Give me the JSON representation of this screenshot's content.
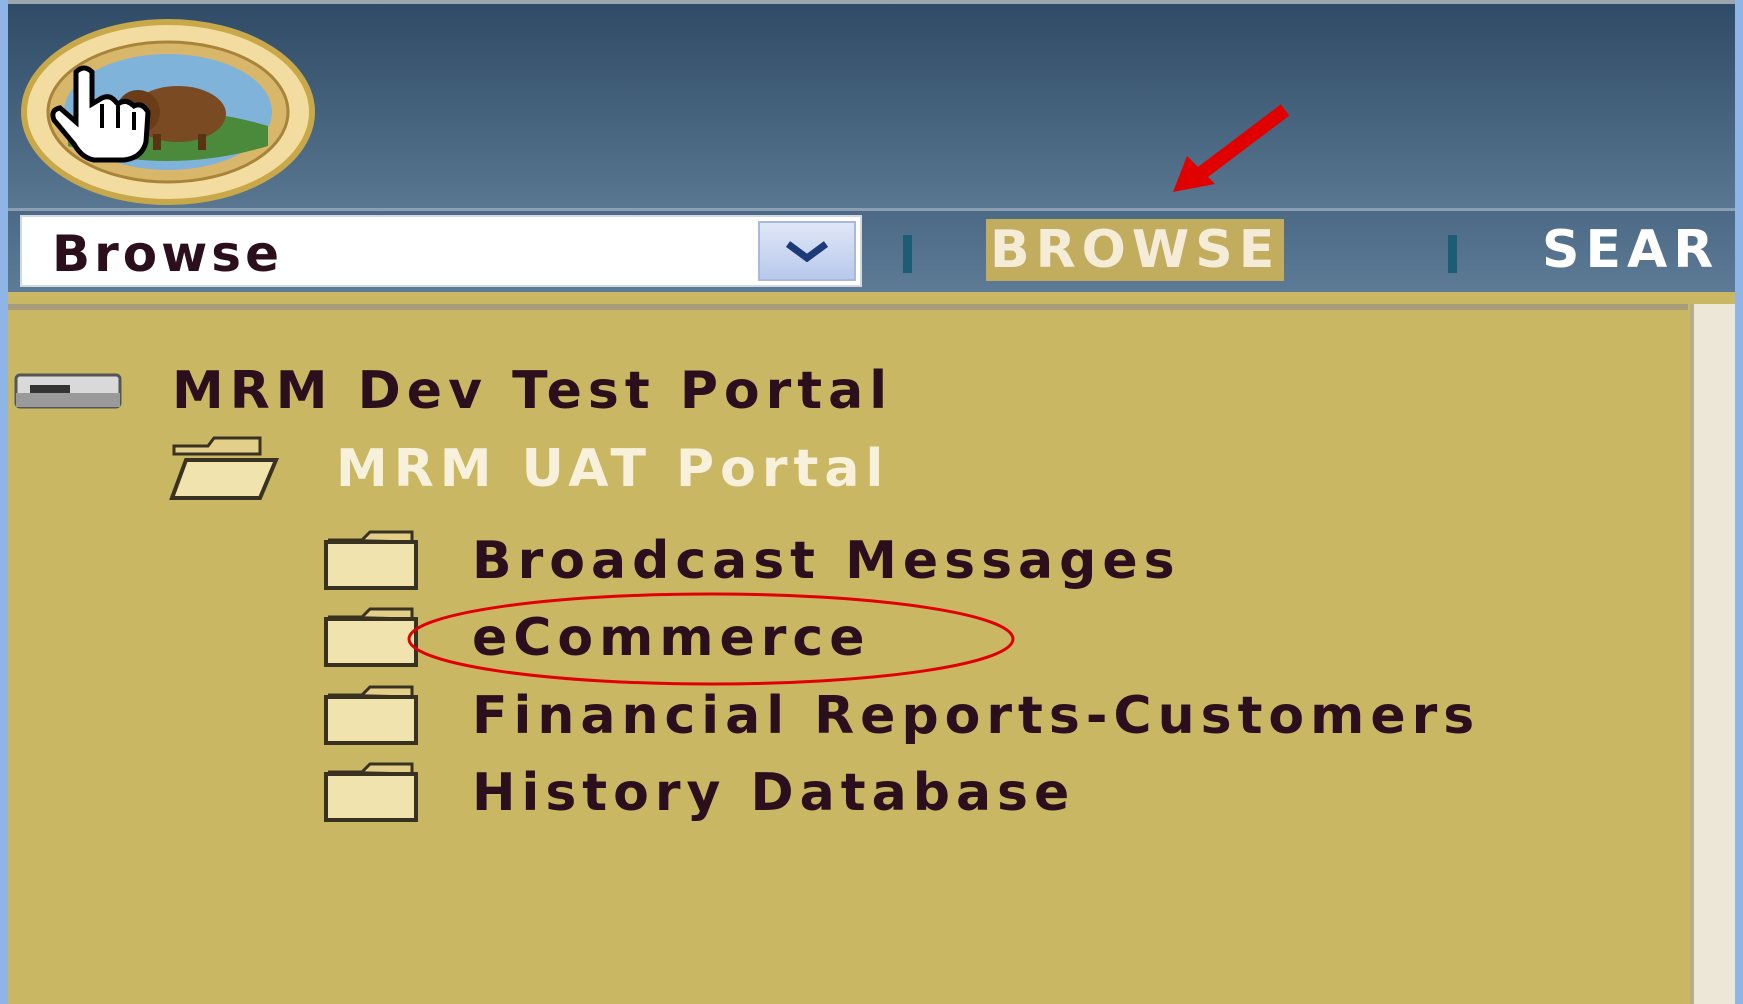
{
  "header": {
    "logo": "seal-logo",
    "cursor": "hand-pointer-icon"
  },
  "navbar": {
    "select_value": "Browse",
    "dropdown_icon": "chevron-down-icon",
    "links": [
      {
        "label": "BROWSE",
        "active": true
      },
      {
        "label": "SEAR",
        "active": false
      }
    ]
  },
  "tree": {
    "root": {
      "label": "MRM Dev Test Portal",
      "icon": "drive-icon"
    },
    "portal": {
      "label": "MRM UAT Portal",
      "icon": "open-folder-icon",
      "selected": true
    },
    "folders": [
      {
        "label": "Broadcast Messages",
        "icon": "folder-icon"
      },
      {
        "label": "eCommerce",
        "icon": "folder-icon",
        "highlighted": true
      },
      {
        "label": "Financial Reports-Customers",
        "icon": "folder-icon"
      },
      {
        "label": "History Database",
        "icon": "folder-icon"
      }
    ]
  },
  "colors": {
    "panel_bg": "#c9b764",
    "header_bg": "#3d5a76",
    "active_nav_bg": "#c2ad5e",
    "annotation_red": "#e00000",
    "text_dark": "#2b0f1c"
  }
}
